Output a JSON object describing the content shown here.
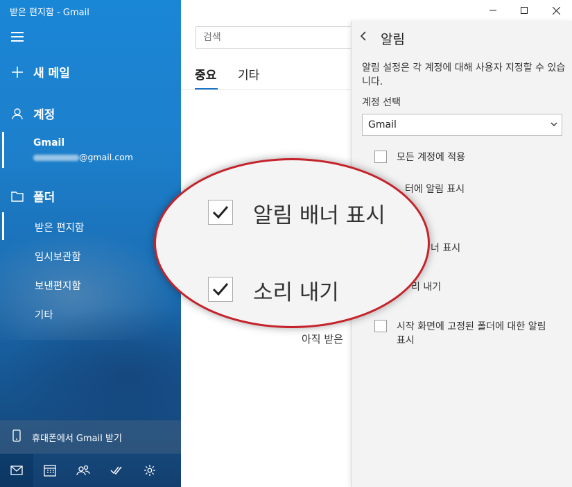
{
  "window": {
    "title": "받은 편지함 - Gmail"
  },
  "sidebar": {
    "new_mail": "새 메일",
    "accounts_header": "계정",
    "account": {
      "name": "Gmail",
      "email_suffix": "@gmail.com"
    },
    "folders_header": "폴더",
    "folders": [
      {
        "label": "받은 편지함"
      },
      {
        "label": "임시보관함"
      },
      {
        "label": "보낸편지함"
      },
      {
        "label": "기타"
      }
    ],
    "phone_prompt": "휴대폰에서 Gmail 받기"
  },
  "main": {
    "search_placeholder": "검색",
    "tabs": [
      {
        "label": "중요"
      },
      {
        "label": "기타"
      }
    ],
    "empty_text": "아직 받은"
  },
  "settings_panel": {
    "title": "알림",
    "description": "알림 설정은 각 계정에 대해 사용자 지정할 수 있습니다.",
    "account_label": "계정 선택",
    "account_selected": "Gmail",
    "options": [
      {
        "label": "모든 계정에 적용"
      },
      {
        "label": "센터에 알림 표시"
      },
      {
        "label": "알림 배너 표시"
      },
      {
        "label": "소리 내기"
      },
      {
        "label": "시작 화면에 고정된 폴더에 대한 알림 표시"
      }
    ],
    "visible_fragments": {
      "opt2": "터에 알림 표시",
      "opt3": "너 표시",
      "opt4": "리 내기"
    }
  },
  "magnifier": {
    "items": [
      {
        "label": "알림 배너 표시",
        "checked": true
      },
      {
        "label": "소리 내기",
        "checked": true
      }
    ],
    "border_color": "#c5222a"
  },
  "colors": {
    "sidebar": "#1a86d6",
    "accent": "#1a73c8"
  }
}
